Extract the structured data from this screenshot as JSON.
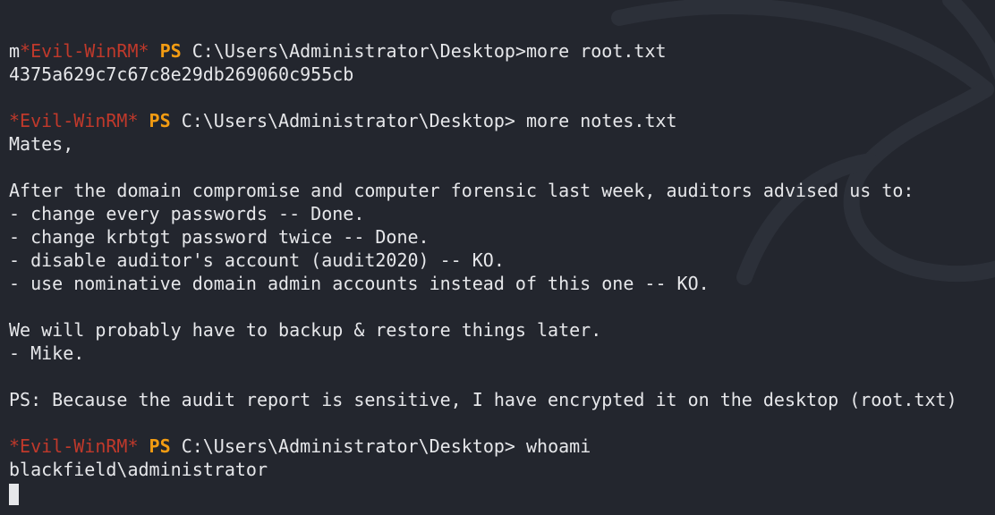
{
  "prompt": {
    "first_prefix": "m",
    "evil": "*Evil-WinRM*",
    "ps": "PS",
    "path": "C:\\Users\\Administrator\\Desktop>"
  },
  "session": [
    {
      "type": "command",
      "prefix": "m",
      "command": "more root.txt"
    },
    {
      "type": "output",
      "text": "4375a629c7c67c8e29db269060c955cb"
    },
    {
      "type": "blank"
    },
    {
      "type": "command",
      "prefix": "",
      "command": " more notes.txt"
    },
    {
      "type": "output",
      "text": "Mates,"
    },
    {
      "type": "blank"
    },
    {
      "type": "output",
      "text": "After the domain compromise and computer forensic last week, auditors advised us to:"
    },
    {
      "type": "output",
      "text": "- change every passwords -- Done."
    },
    {
      "type": "output",
      "text": "- change krbtgt password twice -- Done."
    },
    {
      "type": "output",
      "text": "- disable auditor's account (audit2020) -- KO."
    },
    {
      "type": "output",
      "text": "- use nominative domain admin accounts instead of this one -- KO."
    },
    {
      "type": "blank"
    },
    {
      "type": "output",
      "text": "We will probably have to backup & restore things later."
    },
    {
      "type": "output",
      "text": "- Mike."
    },
    {
      "type": "blank"
    },
    {
      "type": "output",
      "text": "PS: Because the audit report is sensitive, I have encrypted it on the desktop (root.txt)"
    },
    {
      "type": "blank"
    },
    {
      "type": "command",
      "prefix": "",
      "command": " whoami"
    },
    {
      "type": "output",
      "text": "blackfield\\administrator"
    },
    {
      "type": "cursor"
    }
  ],
  "colors": {
    "background": "#23262e",
    "text": "#e6e7ea",
    "evil_winrm": "#c0392b",
    "ps": "#f39c12"
  }
}
